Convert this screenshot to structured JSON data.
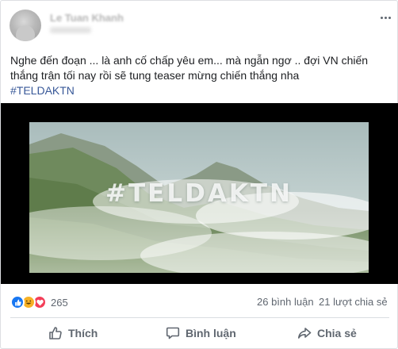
{
  "post": {
    "author": "Le Tuan Khanh",
    "text_lines": [
      "Nghe đến đoạn ... là anh cố chấp yêu em... mà ngẫn ngơ .. đợi VN chiến",
      "thắng trận tối nay rồi sẽ tung teaser mừng chiến thắng nha"
    ],
    "hashtag": "#TELDAKTN"
  },
  "video": {
    "overlay_title": "#TELDAKTN"
  },
  "stats": {
    "reaction_icons": [
      "like-icon",
      "haha-icon",
      "love-icon"
    ],
    "reaction_count": "265",
    "comments": "26 bình luận",
    "shares": "21 lượt chia sẻ"
  },
  "actions": {
    "like": "Thích",
    "comment": "Bình luận",
    "share": "Chia sẻ"
  },
  "colors": {
    "link": "#385898",
    "like_reaction": "#1877f2",
    "haha_reaction": "#f7b125",
    "love_reaction": "#f33e58",
    "secondary_text": "#606770"
  }
}
